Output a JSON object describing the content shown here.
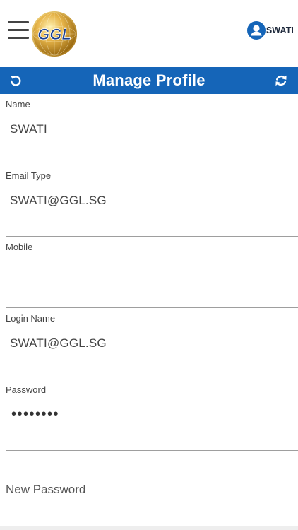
{
  "header": {
    "logo_text": "GGL",
    "user_name": "SWATI"
  },
  "titlebar": {
    "title": "Manage Profile"
  },
  "form": {
    "fields": [
      {
        "label": "Name",
        "value": "SWATI"
      },
      {
        "label": "Email Type",
        "value": "SWATI@GGL.SG"
      },
      {
        "label": "Mobile",
        "value": ""
      },
      {
        "label": "Login Name",
        "value": "SWATI@GGL.SG"
      },
      {
        "label": "Password",
        "value": "••••••••"
      }
    ],
    "new_password": {
      "placeholder": "New Password"
    }
  },
  "colors": {
    "primary": "#1565b8",
    "underline": "#9e9e9e",
    "text": "#444444"
  }
}
